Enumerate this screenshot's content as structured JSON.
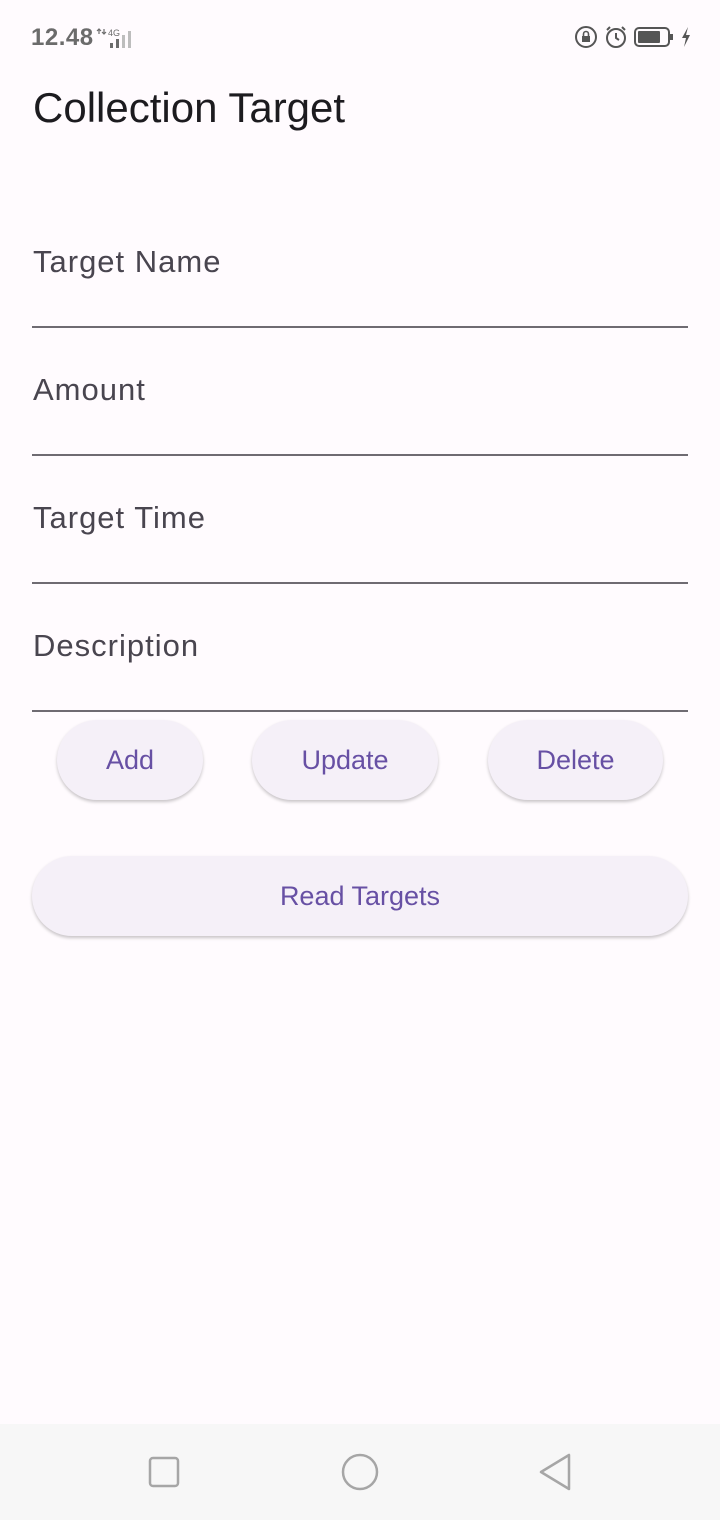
{
  "status_bar": {
    "time": "12.48",
    "network": "4G",
    "icons": [
      "rotation-lock-icon",
      "alarm-icon",
      "battery-icon",
      "charging-icon"
    ]
  },
  "page": {
    "title": "Collection Target"
  },
  "form": {
    "fields": [
      {
        "label": "Target Name",
        "value": ""
      },
      {
        "label": "Amount",
        "value": ""
      },
      {
        "label": "Target Time",
        "value": ""
      },
      {
        "label": "Description",
        "value": ""
      }
    ]
  },
  "actions": {
    "add_label": "Add",
    "update_label": "Update",
    "delete_label": "Delete",
    "read_label": "Read Targets"
  },
  "nav": {
    "icons": [
      "recent-apps-icon",
      "home-icon",
      "back-icon"
    ]
  },
  "colors": {
    "background": "#fffbfe",
    "accent": "#6750a4",
    "button_bg": "#f5f0f8"
  }
}
